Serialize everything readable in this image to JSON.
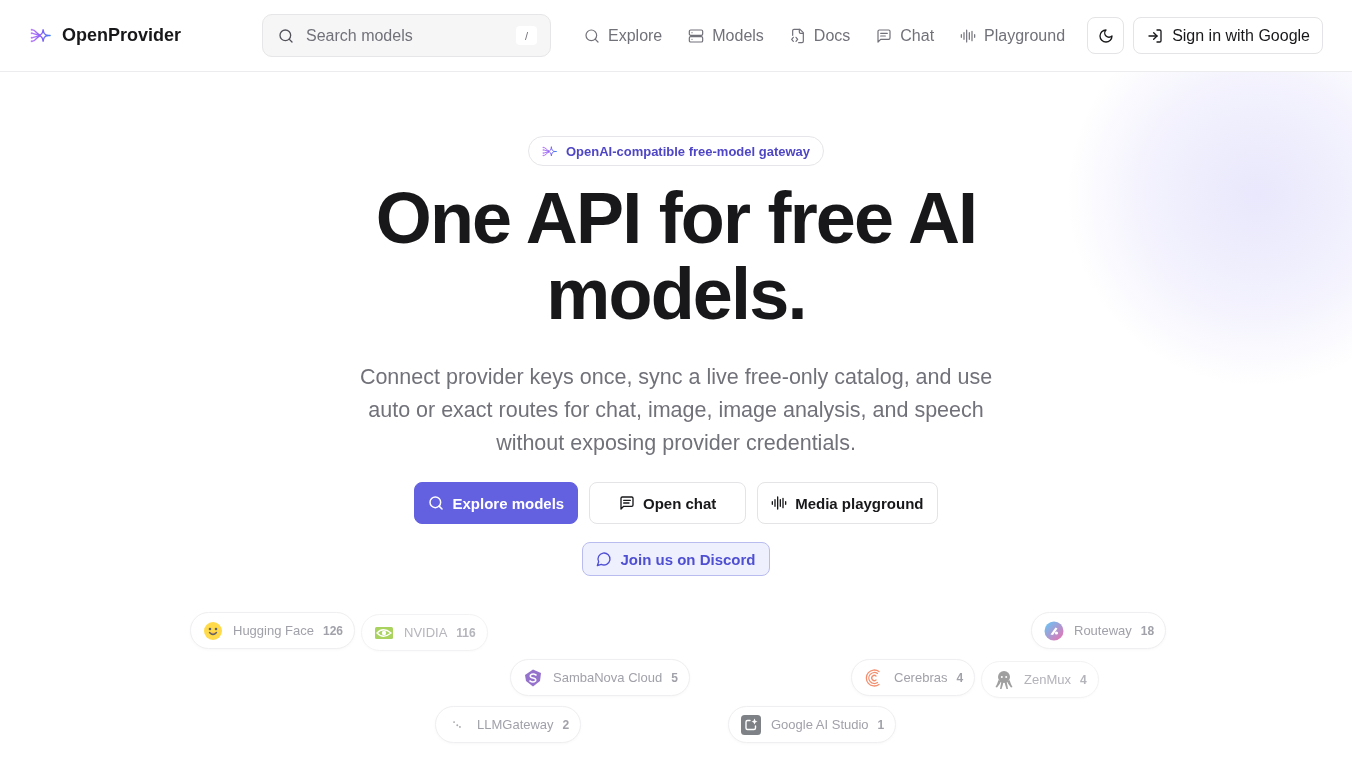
{
  "header": {
    "brand": "OpenProvider",
    "search": {
      "placeholder": "Search models",
      "shortcut": "/"
    },
    "nav": [
      {
        "label": "Explore"
      },
      {
        "label": "Models"
      },
      {
        "label": "Docs"
      },
      {
        "label": "Chat"
      },
      {
        "label": "Playground"
      }
    ],
    "sign_in": {
      "label": "Sign in with Google"
    }
  },
  "hero": {
    "badge": "OpenAI-compatible free-model gateway",
    "title": "One API for free AI models.",
    "subtitle": "Connect provider keys once, sync a live free-only catalog, and use auto or exact routes for chat, image, image analysis, and speech without exposing provider credentials.",
    "actions": [
      {
        "label": "Explore models",
        "kind": "primary"
      },
      {
        "label": "Open chat",
        "kind": "secondary"
      },
      {
        "label": "Media playground",
        "kind": "secondary"
      }
    ],
    "community": {
      "label": "Join us on Discord"
    }
  },
  "providers": [
    {
      "name": "Hugging Face",
      "count": "126"
    },
    {
      "name": "NVIDIA",
      "count": "116"
    },
    {
      "name": "Routeway",
      "count": "18"
    },
    {
      "name": "SambaNova Cloud",
      "count": "5"
    },
    {
      "name": "Cerebras",
      "count": "4"
    },
    {
      "name": "ZenMux",
      "count": "4"
    },
    {
      "name": "LLMGateway",
      "count": "2"
    },
    {
      "name": "Google AI Studio",
      "count": "1"
    }
  ]
}
